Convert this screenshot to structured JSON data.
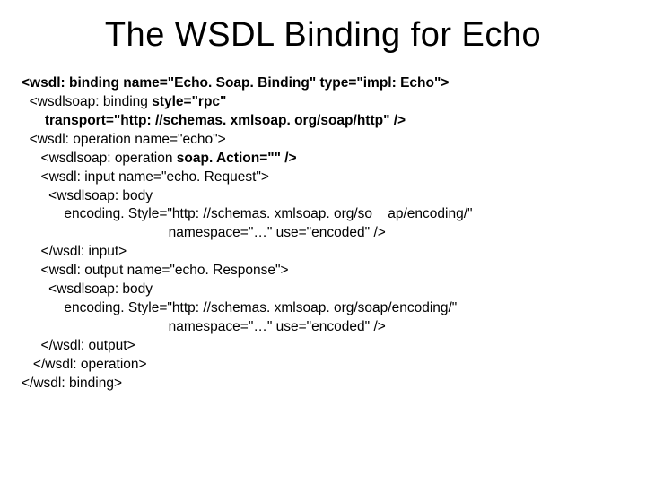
{
  "title": "The WSDL Binding for Echo",
  "code": {
    "l01a": "<wsdl: binding name=\"Echo. Soap. Binding\" type=\"impl: Echo\">",
    "l02a": "  <wsdlsoap: binding ",
    "l02b": "style=\"rpc\"",
    "l03a": "      transport=\"http: //schemas. xmlsoap. org/soap/http\" />",
    "l04a": "  <wsdl: operation name=\"echo\">",
    "l05a": "     <wsdlsoap: operation ",
    "l05b": "soap. Action=\"\" />",
    "l06a": "     <wsdl: input name=\"echo. Request\">",
    "l07a": "       <wsdlsoap: body",
    "l08a": "           encoding. Style=\"http: //schemas. xmlsoap. org/so    ap/encoding/\"",
    "l09a": "                                      namespace=\"…\" use=\"encoded\" />",
    "l10a": "     </wsdl: input>",
    "l11a": "     <wsdl: output name=\"echo. Response\">",
    "l12a": "       <wsdlsoap: body",
    "l13a": "           encoding. Style=\"http: //schemas. xmlsoap. org/soap/encoding/\"",
    "l14a": "                                      namespace=\"…\" use=\"encoded\" />",
    "l15a": "     </wsdl: output>",
    "l16a": "   </wsdl: operation>",
    "l17a": "</wsdl: binding>"
  }
}
